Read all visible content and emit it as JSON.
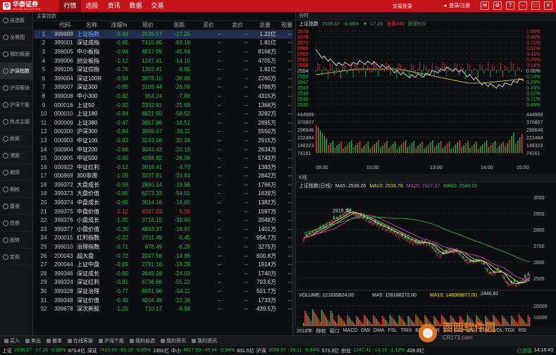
{
  "app": {
    "logo_cn": "华泰证券",
    "logo_en": "HUATAI SECURITIES",
    "login": "交易登录",
    "user": "登录/注册"
  },
  "menu": [
    "行情",
    "选股",
    "资讯",
    "数据",
    "交易"
  ],
  "sidebar": [
    "自选股",
    "全景图",
    "我的板面",
    "沪深指数",
    "沪深板块",
    "沪深个股",
    "热点主题",
    "新股",
    "港股",
    "期货",
    "期权",
    "基金",
    "债券",
    "股转",
    "宏观"
  ],
  "grid": {
    "title": "主要指数",
    "headers": [
      "",
      "代码",
      "名称",
      "涨幅%",
      "现价",
      "涨跌",
      "买价",
      "卖价",
      "总量",
      "现量"
    ],
    "rows": [
      [
        "1",
        "999999",
        "上证指数",
        "-0.68",
        "2536.57",
        "-17.26",
        "--",
        "--",
        "1.22亿",
        "--"
      ],
      [
        "2",
        "399001",
        "深证成指",
        "-0.85",
        "7410.85",
        "-63.16",
        "--",
        "--",
        "1.81亿",
        "--"
      ],
      [
        "3",
        "399005",
        "中小板指",
        "-0.94",
        "4817.69",
        "-45.94",
        "--",
        "--",
        "8168万",
        "--"
      ],
      [
        "4",
        "399006",
        "创业板指",
        "-1.12",
        "1247.41",
        "-14.15",
        "--",
        "--",
        "4705万",
        "--"
      ],
      [
        "5",
        "399106",
        "深证综指",
        "-0.76",
        "1303.41",
        "-9.95",
        "--",
        "--",
        "1.81亿",
        "--"
      ],
      [
        "6",
        "399004",
        "深证100R",
        "-0.94",
        "3878.10",
        "-36.88",
        "--",
        "--",
        "2260万",
        "--"
      ],
      [
        "7",
        "399007",
        "深证300",
        "-0.85",
        "3109.44",
        "-26.59",
        "--",
        "--",
        "4788万",
        "--"
      ],
      [
        "8",
        "399008",
        "中小300",
        "-0.82",
        "954.24",
        "-7.88",
        "--",
        "--",
        "4315万",
        "--"
      ],
      [
        "9",
        "000016",
        "上证50",
        "-0.92",
        "2332.81",
        "-21.69",
        "--",
        "--",
        "1368万",
        "--"
      ],
      [
        "10",
        "000010",
        "上证180",
        "-0.84",
        "6921.60",
        "-58.52",
        "--",
        "--",
        "3282万",
        "--"
      ],
      [
        "11",
        "000009",
        "上证380",
        "-0.47",
        "3957.96",
        "-18.51",
        "--",
        "--",
        "2895万",
        "--"
      ],
      [
        "12",
        "000300",
        "沪深300",
        "-0.84",
        "3068.67",
        "-26.11",
        "--",
        "--",
        "5550万",
        "--"
      ],
      [
        "13",
        "000903",
        "中证100",
        "-0.93",
        "3243.06",
        "-30.34",
        "--",
        "--",
        "2915万",
        "--"
      ],
      [
        "14",
        "000904",
        "中证200",
        "-0.66",
        "3043.43",
        "-20.19",
        "--",
        "--",
        "2634万",
        "--"
      ],
      [
        "15",
        "000905",
        "中证500",
        "-0.60",
        "4288.82",
        "-26.06",
        "--",
        "--",
        "5743万",
        "--"
      ],
      [
        "16",
        "000922",
        "中证红利",
        "-0.12",
        "3918.41",
        "-4.73",
        "--",
        "--",
        "1383万",
        "--"
      ],
      [
        "17",
        "000969",
        "300非周",
        "-1.09",
        "3237.81",
        "-33.84",
        "--",
        "--",
        "2842万",
        "--"
      ],
      [
        "18",
        "399372",
        "大盘成长",
        "-0.69",
        "2860.14",
        "-19.96",
        "--",
        "--",
        "1766万",
        "--"
      ],
      [
        "19",
        "399373",
        "大盘价值",
        "-0.85",
        "6273.33",
        "-54.01",
        "--",
        "--",
        "1639万",
        "--"
      ],
      [
        "20",
        "399374",
        "中盘成长",
        "-0.65",
        "3014.16",
        "-19.65",
        "--",
        "--",
        "1382万",
        "--"
      ],
      [
        "21",
        "399375",
        "中盘价值",
        "0.12",
        "4347.03",
        "5.09",
        "--",
        "--",
        "1597万",
        "--"
      ],
      [
        "22",
        "399376",
        "小盘成长",
        "-1.05",
        "3716.15",
        "-39.60",
        "--",
        "--",
        "2048万",
        "--"
      ],
      [
        "23",
        "399377",
        "小盘价值",
        "-0.35",
        "4843.37",
        "-16.97",
        "--",
        "--",
        "1401万",
        "--"
      ],
      [
        "24",
        "200015",
        "红利指数",
        "-0.22",
        "2511.49",
        "-5.45",
        "--",
        "--",
        "954.7万",
        "--"
      ],
      [
        "25",
        "399010",
        "治理指数",
        "-0.71",
        "878.49",
        "-6.28",
        "--",
        "--",
        "3275万",
        "--"
      ],
      [
        "26",
        "200043",
        "超大盘",
        "-0.72",
        "2047.56",
        "-14.86",
        "--",
        "--",
        "600.8万",
        "--"
      ],
      [
        "27",
        "200044",
        "上证中盘",
        "-0.69",
        "2791.16",
        "-19.28",
        "--",
        "--",
        "1914万",
        "--"
      ],
      [
        "28",
        "399346",
        "深证成长",
        "-0.90",
        "2649.28",
        "-24.03",
        "--",
        "--",
        "1740万",
        "--"
      ],
      [
        "29",
        "399324",
        "深证红利",
        "-0.81",
        "6736.66",
        "-55.22",
        "--",
        "--",
        "793.6万",
        "--"
      ],
      [
        "30",
        "399328",
        "深证治理",
        "-0.77",
        "6991.96",
        "-54.11",
        "--",
        "--",
        "501.7万",
        "--"
      ],
      [
        "31",
        "399348",
        "深证价值",
        "-0.49",
        "4504.49",
        "-22.36",
        "--",
        "--",
        "1733万",
        "--"
      ],
      [
        "32",
        "399678",
        "深次新股",
        "-1.25",
        "710.17",
        "-8.98",
        "--",
        "--",
        "439.5万",
        "--"
      ]
    ]
  },
  "timeshare": {
    "title": "分时",
    "legend_name": "上证指数",
    "legend_price": "2536.57",
    "legend_pct": "-0.68%",
    "legend_chg": "▼ -17.26",
    "legend_up": "涨家446",
    "legend_down": "跌家970",
    "price_ticks": [
      "2579",
      "2576",
      "2572",
      "2569",
      "2565",
      "2561",
      "2558",
      "2554",
      "2550",
      "2547",
      "2543",
      "2539",
      "2536",
      "2532"
    ],
    "pct_ticks": [
      "1.00%",
      "0.86%",
      "0.71%",
      "0.57%",
      "0.43%",
      "0.29%",
      "0.14%",
      "0.00%",
      "0.14%",
      "0.29%",
      "0.43%",
      "0.57%",
      "0.71%",
      "0.86%"
    ],
    "vol_ticks": [
      "444969",
      "370807",
      "296646",
      "222484",
      "148323",
      "74161"
    ],
    "time_ticks": [
      "09:30",
      "10:30",
      "13:00",
      "14:00",
      "15:00"
    ]
  },
  "kline": {
    "title": "K线",
    "legend": {
      "name": "上证指数(日线)",
      "ma5": "MA5: 2539.26",
      "ma10": "MA10: 2516.78",
      "ma20": "MA20: 2527.57",
      "ma60": "MA60: 2589.15"
    },
    "price_ticks": [
      "3000",
      "2900",
      "2800",
      "2700",
      "2600",
      "2500"
    ],
    "high_label": "2915.30",
    "low_label": "2440.91",
    "vol_legend": {
      "vol": "VOLUME: 121635824.00",
      "ma5": "MA5: 156188272.00",
      "ma10": "MA10: 148069872.00"
    },
    "vol_ticks": [
      "20000",
      "10000"
    ],
    "year": "2018年",
    "indicator_tabs": [
      "除权",
      "窗口",
      "MACD",
      "DMI",
      "DMA",
      "FSL",
      "TRIX",
      "BRAR",
      "CR",
      "VR",
      "OBV",
      "ASI",
      "EMV",
      "VOL-TDX",
      "RSI"
    ]
  },
  "colors": {
    "up": "#e63c3c",
    "down": "#2fb44a",
    "brand": "#c4141a",
    "ma5": "#ffffff",
    "ma10": "#f0e030",
    "ma20": "#e040e0",
    "ma60": "#30c050"
  },
  "bottom_tabs": [
    "买入",
    "卖出",
    "撤单",
    "在线客服",
    "沪深个股",
    "我的自选",
    "我的资讯",
    "我的资讯"
  ],
  "status": {
    "sh_name": "上证",
    "sh_price": "2536.57",
    "sh_chg": "-17.26",
    "sh_pct": "-0.68%",
    "sh_amt": "973.4亿",
    "sz_name": "深证",
    "sz_price": "7410.85",
    "sz_chg": "-63.16",
    "sz_pct": "-0.85%",
    "sz_amt": "1391亿",
    "zx_name": "中小",
    "zx_price": "4817.69",
    "zx_chg": "-45.94",
    "zx_pct": "-0.94%",
    "zx_amt": "631.5亿",
    "hs_name": "沪深",
    "hs_price": "3068.67",
    "hs_chg": "-26.11",
    "hs_pct": "-0.84%",
    "hs_amt": "573.3亿",
    "cy_name": "创业",
    "cy_price": "1247.41",
    "cy_chg": "-14.15",
    "cy_pct": "-1.12%",
    "cy_amt": "428.8亿",
    "conn": "已连接",
    "time": "14:18:43"
  },
  "watermark": {
    "cn": "西西软件园",
    "url": "CR173.com"
  }
}
